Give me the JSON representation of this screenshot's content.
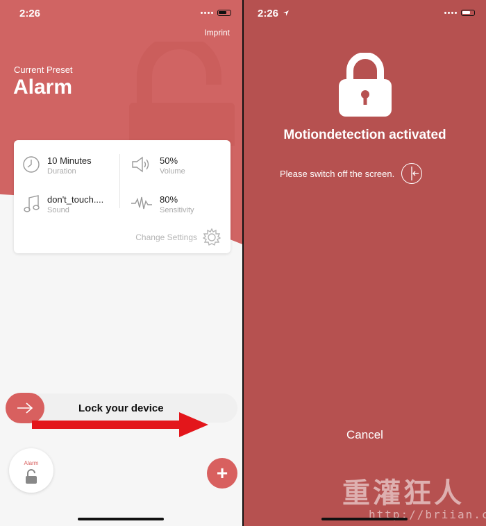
{
  "left_screen": {
    "status": {
      "time": "2:26"
    },
    "header": {
      "imprint_link": "Imprint",
      "preset_caption": "Current Preset",
      "preset_name": "Alarm"
    },
    "settings_card": {
      "duration": {
        "value": "10 Minutes",
        "label": "Duration",
        "icon": "clock-icon"
      },
      "volume": {
        "value": "50%",
        "label": "Volume",
        "icon": "speaker-icon"
      },
      "sound": {
        "value": "don't_touch....",
        "label": "Sound",
        "icon": "music-note-icon"
      },
      "sensitivity": {
        "value": "80%",
        "label": "Sensitivity",
        "icon": "waveform-icon"
      },
      "change_settings": "Change Settings"
    },
    "lock_slider": {
      "label": "Lock your device"
    },
    "bottom_bar": {
      "preset_label": "Alarm",
      "add_button": "+"
    },
    "colors": {
      "accent": "#d8605f",
      "header_bg": "#d06463"
    }
  },
  "right_screen": {
    "status": {
      "time": "2:26"
    },
    "title": "Motiondetection activated",
    "instruction": "Please switch off the screen.",
    "cancel_button": "Cancel",
    "watermark": {
      "cjk": "重灌狂人",
      "url": "http://briian.com"
    },
    "colors": {
      "background": "#b65150"
    }
  }
}
